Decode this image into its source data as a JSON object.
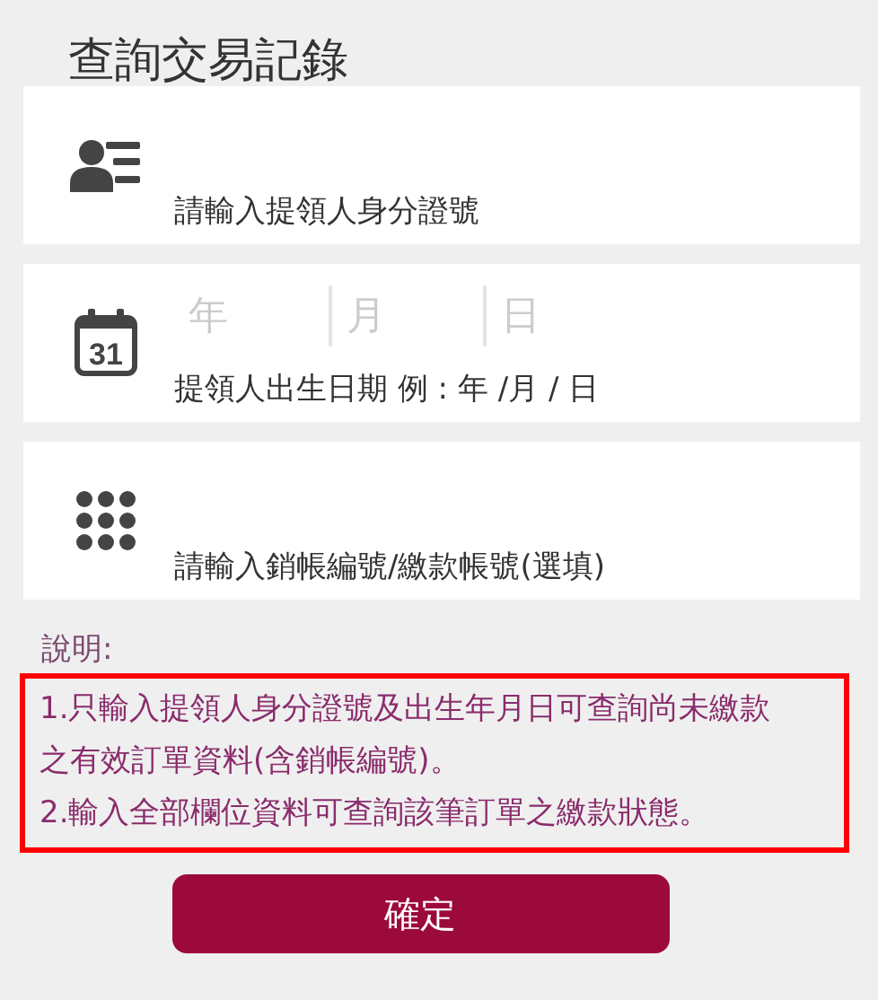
{
  "title": "查詢交易記錄",
  "fields": [
    {
      "kind": "id",
      "label": "請輸入提領人身分證號"
    },
    {
      "kind": "date",
      "icon_text": "31",
      "parts": [
        {
          "placeholder": "年"
        },
        {
          "placeholder": "月"
        },
        {
          "placeholder": "日"
        }
      ],
      "label": "提領人出生日期 例 : 年 /月 / 日"
    },
    {
      "kind": "keypad",
      "label": "請輸入銷帳編號/繳款帳號(選填)"
    }
  ],
  "note": {
    "heading": "說明:",
    "lines": [
      "1.只輸入提領人身分證號及出生年月日可查詢尚未繳款之有效訂單資料(含銷帳編號)。",
      "2.輸入全部欄位資料可查詢該筆訂單之繳款狀態。"
    ]
  },
  "button": "確定"
}
